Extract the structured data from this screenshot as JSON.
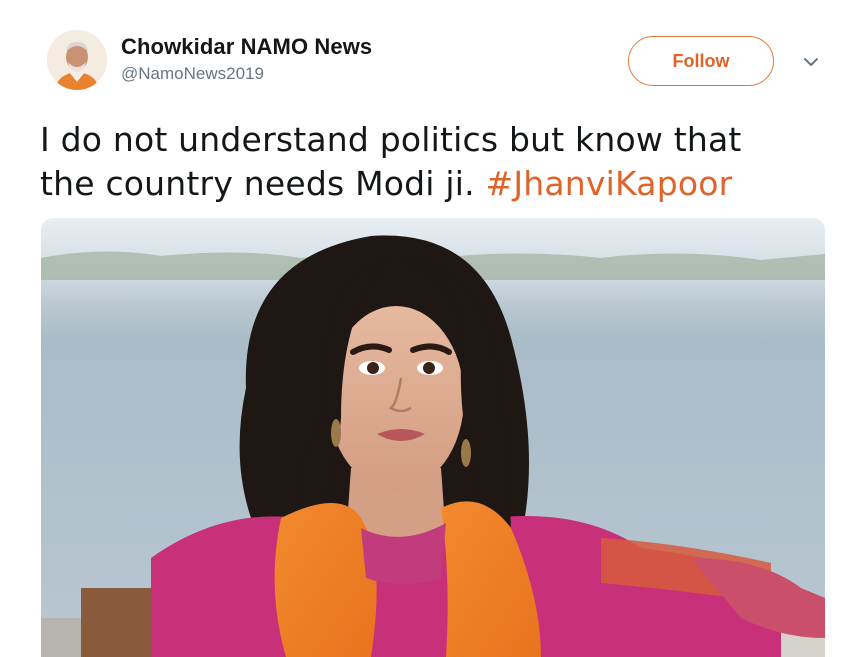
{
  "author": {
    "display_name": "Chowkidar NAMO News",
    "handle": "@NamoNews2019"
  },
  "actions": {
    "follow_label": "Follow",
    "menu_icon": "chevron-down-icon"
  },
  "tweet": {
    "text_line1": "I do not understand politics but know that",
    "text_line2": "the country needs Modi ji.",
    "hashtag": "#JhanviKapoor"
  },
  "media": {
    "type": "photo"
  },
  "colors": {
    "accent": "#e0632a",
    "handle_gray": "#657786",
    "text": "#14171a"
  }
}
